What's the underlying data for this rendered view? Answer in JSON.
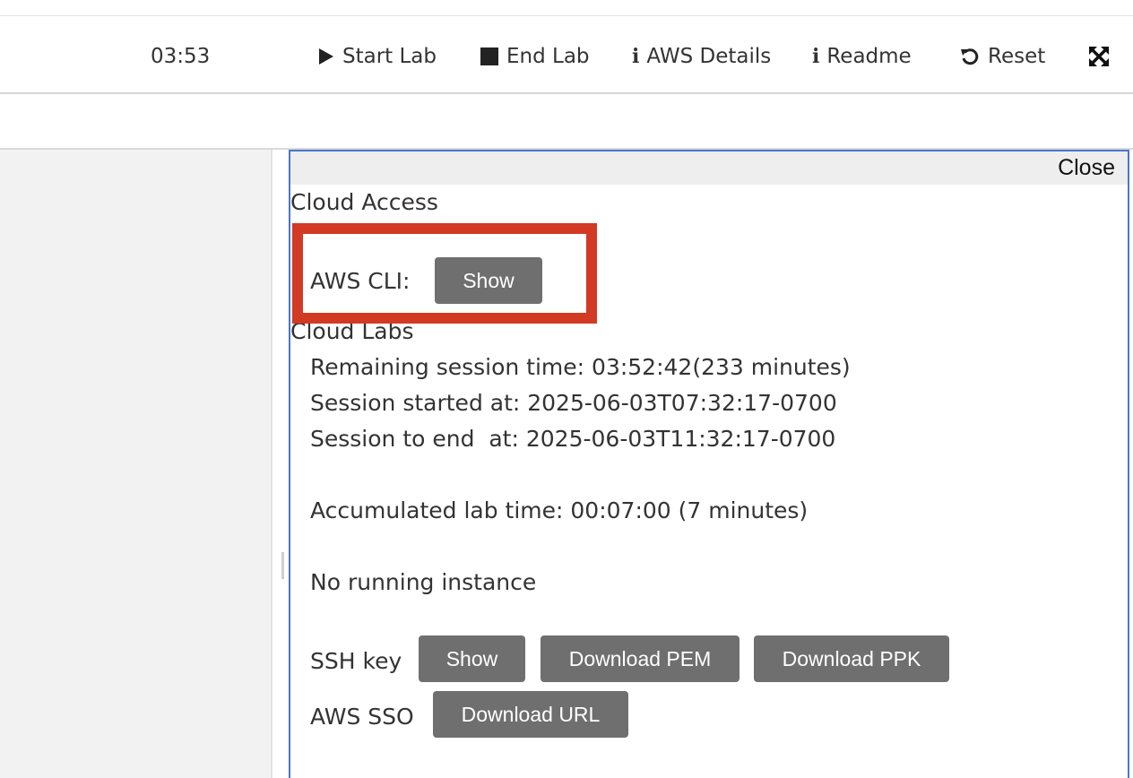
{
  "toolbar": {
    "timer": "03:53",
    "start_lab": "Start Lab",
    "end_lab": "End Lab",
    "aws_details": "AWS Details",
    "readme": "Readme",
    "reset": "Reset",
    "info_glyph": "i",
    "icons": {
      "start": "play-icon",
      "end": "stop-icon",
      "aws_details": "info-icon",
      "readme": "info-icon",
      "reset": "undo-icon",
      "fullscreen": "fullscreen-icon"
    }
  },
  "dialog": {
    "close_label": "Close",
    "cloud_access": {
      "title": "Cloud Access",
      "aws_cli_label": "AWS CLI:",
      "show_label": "Show"
    },
    "cloud_labs": {
      "title": "Cloud Labs",
      "remaining": "Remaining session time: 03:52:42(233 minutes)",
      "started": "Session started at: 2025-06-03T07:32:17-0700",
      "to_end": "Session to end  at: 2025-06-03T11:32:17-0700",
      "accumulated": "Accumulated lab time: 00:07:00 (7 minutes)",
      "instance_status": "No running instance"
    },
    "ssh": {
      "label": "SSH key",
      "show": "Show",
      "download_pem": "Download PEM",
      "download_ppk": "Download PPK"
    },
    "sso": {
      "label": "AWS SSO",
      "download_url": "Download URL"
    }
  },
  "colors": {
    "highlight": "#d33a24",
    "dialog_border": "#4a76c9",
    "button_bg": "#6f6f6f",
    "left_pane": "#f2f2f2"
  }
}
